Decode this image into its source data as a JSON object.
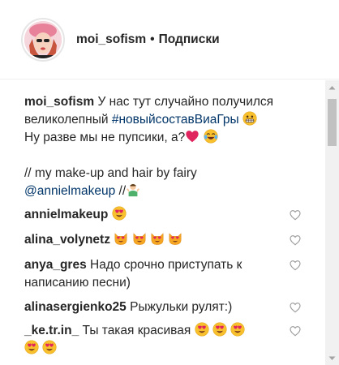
{
  "header": {
    "username": "moi_sofism",
    "separator": "•",
    "follow_label": "Подписки"
  },
  "caption": {
    "author": "moi_sofism",
    "line1_text": "У нас тут случайно получился",
    "line2_text": "великолепный ",
    "hashtag": "#новыйсоставВиаГры",
    "line3_text": "Ну разве мы не пупсики, а?",
    "line5_text": "// my make-up and hair by fairy",
    "mention": "@annielmakeup",
    "line6_suffix": " //"
  },
  "comments": [
    {
      "author": "annielmakeup",
      "text": ""
    },
    {
      "author": "alina_volynetz",
      "text": ""
    },
    {
      "author": "anya_gres",
      "text": "Надо срочно приступать к",
      "text_cont": "написанию песни)"
    },
    {
      "author": "alinasergienko25",
      "text": "Рыжульки рулят:)"
    },
    {
      "author": "_ke.tr.in_",
      "text": "Ты такая красивая"
    }
  ],
  "icons": {
    "heart": "heart-outline-icon",
    "grimace": "grimacing-face-emoji",
    "red_heart": "red-heart-emoji",
    "joy": "face-with-tears-of-joy-emoji",
    "shrug": "person-shrugging-emoji",
    "heart_eyes": "smiling-face-with-heart-eyes-emoji",
    "heart_eyes_cat": "smiling-cat-with-heart-eyes-emoji"
  },
  "colors": {
    "link": "#003569",
    "text": "#262626",
    "divider": "#efefef",
    "emoji_yellow": "#f7c02c",
    "heart_red": "#e0245e"
  }
}
